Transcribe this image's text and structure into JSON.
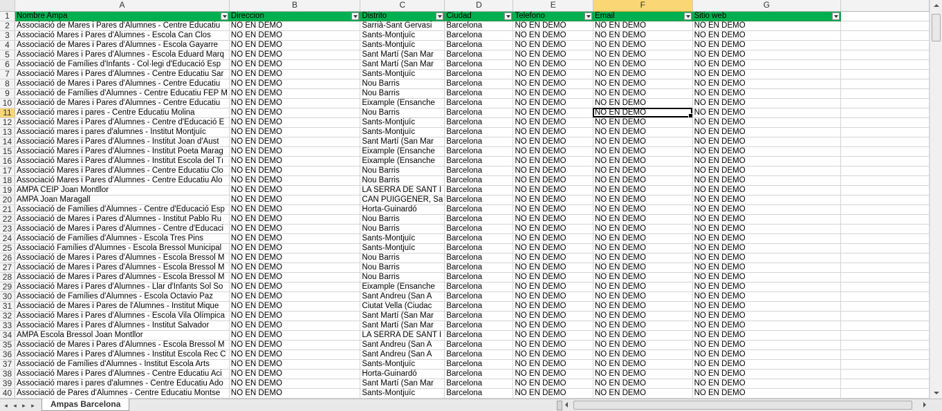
{
  "sheet": {
    "columns": [
      "A",
      "B",
      "C",
      "D",
      "E",
      "F",
      "G"
    ],
    "active_column": "F",
    "active_row": 11,
    "headers": [
      "Nombre Ampa",
      "Direccion",
      "Distrito",
      "Ciudad",
      "Telefono",
      "Email",
      "Sitio web"
    ],
    "rows": [
      {
        "n": "2",
        "a": "Associació de Mares i Pares d'Alumnes - Centre Educatiu",
        "b": "NO EN DEMO",
        "c": "Sarrià-Sant Gervasi",
        "d": "Barcelona",
        "e": "NO EN DEMO",
        "f": "NO EN DEMO",
        "g": "NO EN DEMO"
      },
      {
        "n": "3",
        "a": "Associació Mares i Pares d'Alumnes - Escola Can Clos",
        "b": "NO EN DEMO",
        "c": "Sants-Montjuïc",
        "d": "Barcelona",
        "e": "NO EN DEMO",
        "f": "NO EN DEMO",
        "g": "NO EN DEMO"
      },
      {
        "n": "4",
        "a": "Associació de Mares i Pares d'Alumnes - Escola Gayarre",
        "b": "NO EN DEMO",
        "c": "Sants-Montjuïc",
        "d": "Barcelona",
        "e": "NO EN DEMO",
        "f": "NO EN DEMO",
        "g": "NO EN DEMO"
      },
      {
        "n": "5",
        "a": "Associació Mares i Pares d'Alumnes - Escola Eduard Marq",
        "b": "NO EN DEMO",
        "c": "Sant Martí (San Mar",
        "d": "Barcelona",
        "e": "NO EN DEMO",
        "f": "NO EN DEMO",
        "g": "NO EN DEMO"
      },
      {
        "n": "6",
        "a": "Associació de Famílies d'Infants - Col·legi d'Educació Esp",
        "b": "NO EN DEMO",
        "c": "Sant Martí (San Mar",
        "d": "Barcelona",
        "e": "NO EN DEMO",
        "f": "NO EN DEMO",
        "g": "NO EN DEMO"
      },
      {
        "n": "7",
        "a": "Associació Mares i Pares d'Alumnes - Centre Educatiu Sar",
        "b": "NO EN DEMO",
        "c": "Sants-Montjuïc",
        "d": "Barcelona",
        "e": "NO EN DEMO",
        "f": "NO EN DEMO",
        "g": "NO EN DEMO"
      },
      {
        "n": "8",
        "a": "Associació de Mares i Pares d'Alumnes - Centre Educatiu",
        "b": "NO EN DEMO",
        "c": "Nou Barris",
        "d": "Barcelona",
        "e": "NO EN DEMO",
        "f": "NO EN DEMO",
        "g": "NO EN DEMO"
      },
      {
        "n": "9",
        "a": "Associació de Famílies d'Alumnes - Centre Educatiu FEP M",
        "b": "NO EN DEMO",
        "c": "Nou Barris",
        "d": "Barcelona",
        "e": "NO EN DEMO",
        "f": "NO EN DEMO",
        "g": "NO EN DEMO"
      },
      {
        "n": "10",
        "a": "Associació de Mares i Pares d'Alumnes - Centre Educatiu",
        "b": "NO EN DEMO",
        "c": "Eixample (Ensanche",
        "d": "Barcelona",
        "e": "NO EN DEMO",
        "f": "NO EN DEMO",
        "g": "NO EN DEMO"
      },
      {
        "n": "11",
        "a": "Associació mares i pares - Centre Educatiu Molina",
        "b": "NO EN DEMO",
        "c": "Nou Barris",
        "d": "Barcelona",
        "e": "NO EN DEMO",
        "f": "NO EN DEMO",
        "g": "NO EN DEMO"
      },
      {
        "n": "12",
        "a": "Associació Mares i Pares d'Alumnes - Centre d'Educació E",
        "b": "NO EN DEMO",
        "c": "Sants-Montjuïc",
        "d": "Barcelona",
        "e": "NO EN DEMO",
        "f": "NO EN DEMO",
        "g": "NO EN DEMO"
      },
      {
        "n": "13",
        "a": "Associació mares i pares d'alumnes - Institut Montjuïc",
        "b": "NO EN DEMO",
        "c": "Sants-Montjuïc",
        "d": "Barcelona",
        "e": "NO EN DEMO",
        "f": "NO EN DEMO",
        "g": "NO EN DEMO"
      },
      {
        "n": "14",
        "a": "Associació Mares i Pares d'Alumnes - Institut Joan d'Àust",
        "b": "NO EN DEMO",
        "c": "Sant Martí (San Mar",
        "d": "Barcelona",
        "e": "NO EN DEMO",
        "f": "NO EN DEMO",
        "g": "NO EN DEMO"
      },
      {
        "n": "15",
        "a": "Associació Mares i Pares d'Alumnes - Institut Poeta Marag",
        "b": "NO EN DEMO",
        "c": "Eixample (Ensanche",
        "d": "Barcelona",
        "e": "NO EN DEMO",
        "f": "NO EN DEMO",
        "g": "NO EN DEMO"
      },
      {
        "n": "16",
        "a": "Associació Mares i Pares d'Alumnes - Institut Escola del Tı",
        "b": "NO EN DEMO",
        "c": "Eixample (Ensanche",
        "d": "Barcelona",
        "e": "NO EN DEMO",
        "f": "NO EN DEMO",
        "g": "NO EN DEMO"
      },
      {
        "n": "17",
        "a": "Associació Mares i Pares d'Alumnes - Centre Educatiu Clo",
        "b": "NO EN DEMO",
        "c": "Nou Barris",
        "d": "Barcelona",
        "e": "NO EN DEMO",
        "f": "NO EN DEMO",
        "g": "NO EN DEMO"
      },
      {
        "n": "18",
        "a": "Associació Mares i Pares d'Alumnes - Centre Educatiu Alo",
        "b": "NO EN DEMO",
        "c": "Nou Barris",
        "d": "Barcelona",
        "e": "NO EN DEMO",
        "f": "NO EN DEMO",
        "g": "NO EN DEMO"
      },
      {
        "n": "19",
        "a": "AMPA CEIP Joan Montllor",
        "b": "NO EN DEMO",
        "c": "LA SERRA DE SANT I",
        "d": "Barcelona",
        "e": "NO EN DEMO",
        "f": "NO EN DEMO",
        "g": "NO EN DEMO"
      },
      {
        "n": "20",
        "a": "AMPA Joan Maragall",
        "b": "NO EN DEMO",
        "c": "CAN PUIGGENER, Sa",
        "d": "Barcelona",
        "e": "NO EN DEMO",
        "f": "NO EN DEMO",
        "g": "NO EN DEMO"
      },
      {
        "n": "21",
        "a": "Associació de Famílies d'Alumnes - Centre d'Educació Esp",
        "b": "NO EN DEMO",
        "c": "Horta-Guinardó",
        "d": "Barcelona",
        "e": "NO EN DEMO",
        "f": "NO EN DEMO",
        "g": "NO EN DEMO"
      },
      {
        "n": "22",
        "a": "Associació de Mares i Pares d'Alumnes - Institut Pablo Ru",
        "b": "NO EN DEMO",
        "c": "Nou Barris",
        "d": "Barcelona",
        "e": "NO EN DEMO",
        "f": "NO EN DEMO",
        "g": "NO EN DEMO"
      },
      {
        "n": "23",
        "a": "Associació de Mares i Pares d'Alumnes - Centre d'Educaci",
        "b": "NO EN DEMO",
        "c": "Nou Barris",
        "d": "Barcelona",
        "e": "NO EN DEMO",
        "f": "NO EN DEMO",
        "g": "NO EN DEMO"
      },
      {
        "n": "24",
        "a": "Associació de Famílies d'Alumnes - Escola Tres Pins",
        "b": "NO EN DEMO",
        "c": "Sants-Montjuïc",
        "d": "Barcelona",
        "e": "NO EN DEMO",
        "f": "NO EN DEMO",
        "g": "NO EN DEMO"
      },
      {
        "n": "25",
        "a": "Associació Famílies d'Alumnes - Escola Bressol Municipal",
        "b": "NO EN DEMO",
        "c": "Sants-Montjuïc",
        "d": "Barcelona",
        "e": "NO EN DEMO",
        "f": "NO EN DEMO",
        "g": "NO EN DEMO"
      },
      {
        "n": "26",
        "a": "Associació de Mares i Pares d'Alumnes - Escola Bressol M",
        "b": "NO EN DEMO",
        "c": "Nou Barris",
        "d": "Barcelona",
        "e": "NO EN DEMO",
        "f": "NO EN DEMO",
        "g": "NO EN DEMO"
      },
      {
        "n": "27",
        "a": "Associació de Mares i Pares d'Alumnes - Escola Bressol M",
        "b": "NO EN DEMO",
        "c": "Nou Barris",
        "d": "Barcelona",
        "e": "NO EN DEMO",
        "f": "NO EN DEMO",
        "g": "NO EN DEMO"
      },
      {
        "n": "28",
        "a": "Associació de Mares i Pares d'Alumnes - Escola Bressol M",
        "b": "NO EN DEMO",
        "c": "Nou Barris",
        "d": "Barcelona",
        "e": "NO EN DEMO",
        "f": "NO EN DEMO",
        "g": "NO EN DEMO"
      },
      {
        "n": "29",
        "a": "Associació Mares i Pares d'Alumnes - Llar d'Infants Sol So",
        "b": "NO EN DEMO",
        "c": "Eixample (Ensanche",
        "d": "Barcelona",
        "e": "NO EN DEMO",
        "f": "NO EN DEMO",
        "g": "NO EN DEMO"
      },
      {
        "n": "30",
        "a": "Associació de Famílies d'Alumnes - Escola Octavio Paz",
        "b": "NO EN DEMO",
        "c": "Sant Andreu (San A",
        "d": "Barcelona",
        "e": "NO EN DEMO",
        "f": "NO EN DEMO",
        "g": "NO EN DEMO"
      },
      {
        "n": "31",
        "a": "Associació de Mares i Pares de l'Alumnes - Institut Mique",
        "b": "NO EN DEMO",
        "c": "Ciutat Vella (Ciudac",
        "d": "Barcelona",
        "e": "NO EN DEMO",
        "f": "NO EN DEMO",
        "g": "NO EN DEMO"
      },
      {
        "n": "32",
        "a": "Associació Mares i Pares d'Alumnes - Escola Vila Olímpica",
        "b": "NO EN DEMO",
        "c": "Sant Martí (San Mar",
        "d": "Barcelona",
        "e": "NO EN DEMO",
        "f": "NO EN DEMO",
        "g": "NO EN DEMO"
      },
      {
        "n": "33",
        "a": "Associació Mares i Pares d'Alumnes - Institut Salvador",
        "b": "NO EN DEMO",
        "c": "Sant Martí (San Mar",
        "d": "Barcelona",
        "e": "NO EN DEMO",
        "f": "NO EN DEMO",
        "g": "NO EN DEMO"
      },
      {
        "n": "34",
        "a": "AMPA Escola Bressol Joan Montllor",
        "b": "NO EN DEMO",
        "c": "LA SERRA DE SANT I",
        "d": "Barcelona",
        "e": "NO EN DEMO",
        "f": "NO EN DEMO",
        "g": "NO EN DEMO"
      },
      {
        "n": "35",
        "a": "Associació de Mares i Pares d'Alumnes - Escola Bressol M",
        "b": "NO EN DEMO",
        "c": "Sant Andreu (San A",
        "d": "Barcelona",
        "e": "NO EN DEMO",
        "f": "NO EN DEMO",
        "g": "NO EN DEMO"
      },
      {
        "n": "36",
        "a": "Associació Mares i Pares d'Alumnes - Institut Escola Rec C",
        "b": "NO EN DEMO",
        "c": "Sant Andreu (San A",
        "d": "Barcelona",
        "e": "NO EN DEMO",
        "f": "NO EN DEMO",
        "g": "NO EN DEMO"
      },
      {
        "n": "37",
        "a": "Associació de Famílies d'Alumnes - Institut Escola Arts",
        "b": "NO EN DEMO",
        "c": "Sants-Montjuïc",
        "d": "Barcelona",
        "e": "NO EN DEMO",
        "f": "NO EN DEMO",
        "g": "NO EN DEMO"
      },
      {
        "n": "38",
        "a": "Associació Mares i Pares d'Alumnes - Centre Educatiu Aci",
        "b": "NO EN DEMO",
        "c": "Horta-Guinardó",
        "d": "Barcelona",
        "e": "NO EN DEMO",
        "f": "NO EN DEMO",
        "g": "NO EN DEMO"
      },
      {
        "n": "39",
        "a": "Associació mares i pares d'alumnes - Centre Educatiu Ado",
        "b": "NO EN DEMO",
        "c": "Sant Martí (San Mar",
        "d": "Barcelona",
        "e": "NO EN DEMO",
        "f": "NO EN DEMO",
        "g": "NO EN DEMO"
      },
      {
        "n": "40",
        "a": "Associació de Pares d'Alumnes - Centre Educatiu Montse",
        "b": "NO EN DEMO",
        "c": "Sants-Montjuïc",
        "d": "Barcelona",
        "e": "NO EN DEMO",
        "f": "NO EN DEMO",
        "g": "NO EN DEMO"
      }
    ]
  },
  "tabs": {
    "active_sheet": "Ampas Barcelona",
    "nav": [
      "first-sheet-icon",
      "prev-sheet-icon",
      "next-sheet-icon",
      "last-sheet-icon"
    ]
  },
  "colors": {
    "header_fill": "#00b050",
    "active_header": "#fbd674",
    "gridline": "#d4d4d4"
  }
}
